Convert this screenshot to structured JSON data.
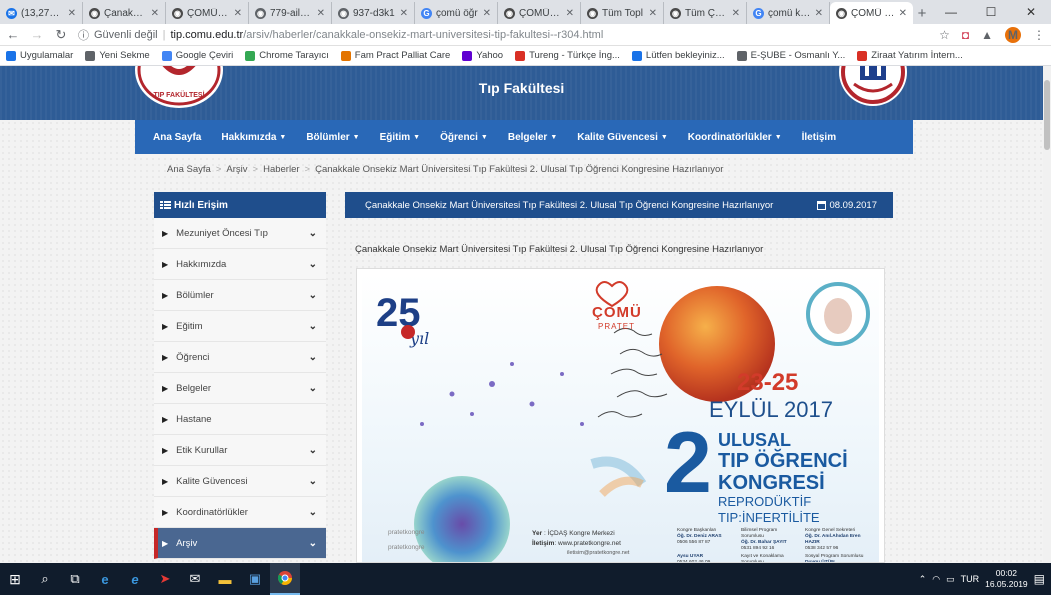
{
  "browser": {
    "tabs": [
      {
        "title": "(13,276 un",
        "color": "#1a73e8",
        "glyph": "✉"
      },
      {
        "title": "Çanakkale",
        "color": "#4a4a4a",
        "glyph": "◉"
      },
      {
        "title": "ÇOMÜ - T",
        "color": "#4a4a4a",
        "glyph": "◉"
      },
      {
        "title": "779-aile-h",
        "color": "#5f6368",
        "glyph": "◉"
      },
      {
        "title": "937-d3k1",
        "color": "#5f6368",
        "glyph": "◉"
      },
      {
        "title": "çomü öğr",
        "color": "#4285f4",
        "glyph": "G"
      },
      {
        "title": "ÇOMÜ - S",
        "color": "#4a4a4a",
        "glyph": "◉"
      },
      {
        "title": "Tüm Topl",
        "color": "#4a4a4a",
        "glyph": "◉"
      },
      {
        "title": "Tüm ÇOM",
        "color": "#4a4a4a",
        "glyph": "◉"
      },
      {
        "title": "çomü kök",
        "color": "#4285f4",
        "glyph": "G"
      },
      {
        "title": "ÇOMÜ - T",
        "color": "#4a4a4a",
        "glyph": "◉",
        "active": true
      }
    ],
    "new_tab": "+",
    "url_security": "Güvenli değil",
    "url_host": "tip.comu.edu.tr",
    "url_path": "/arsiv/haberler/canakkale-onsekiz-mart-universitesi-tip-fakultesi--r304.html",
    "avatar_letter": "M",
    "bookmarks": [
      {
        "label": "Uygulamalar",
        "color": "#1a73e8"
      },
      {
        "label": "Yeni Sekme",
        "color": "#5f6368"
      },
      {
        "label": "Google Çeviri",
        "color": "#4285f4"
      },
      {
        "label": "Chrome Tarayıcı",
        "color": "#34a853"
      },
      {
        "label": "Fam Pract Palliat Care",
        "color": "#e37400"
      },
      {
        "label": "Yahoo",
        "color": "#5f01d1"
      },
      {
        "label": "Tureng - Türkçe İng...",
        "color": "#d93025"
      },
      {
        "label": "Lütfen bekleyiniz...",
        "color": "#1a73e8"
      },
      {
        "label": "E-ŞUBE - Osmanlı Y...",
        "color": "#5f6368"
      },
      {
        "label": "Ziraat Yatırım İntern...",
        "color": "#d93025"
      }
    ]
  },
  "site": {
    "header_title": "Tıp Fakültesi",
    "menu": [
      {
        "label": "Ana Sayfa",
        "caret": false
      },
      {
        "label": "Hakkımızda",
        "caret": true
      },
      {
        "label": "Bölümler",
        "caret": true
      },
      {
        "label": "Eğitim",
        "caret": true
      },
      {
        "label": "Öğrenci",
        "caret": true
      },
      {
        "label": "Belgeler",
        "caret": true
      },
      {
        "label": "Kalite Güvencesi",
        "caret": true
      },
      {
        "label": "Koordinatörlükler",
        "caret": true
      },
      {
        "label": "İletişim",
        "caret": false
      }
    ],
    "breadcrumb": [
      "Ana Sayfa",
      "Arşiv",
      "Haberler",
      "Çanakkale Onsekiz Mart Üniversitesi Tıp Fakültesi 2. Ulusal Tıp Öğrenci Kongresine Hazırlanıyor"
    ],
    "sidebar_title": "Hızlı Erişim",
    "sidebar_items": [
      {
        "label": "Mezuniyet Öncesi Tıp",
        "expandable": true
      },
      {
        "label": "Hakkımızda",
        "expandable": true
      },
      {
        "label": "Bölümler",
        "expandable": true
      },
      {
        "label": "Eğitim",
        "expandable": true
      },
      {
        "label": "Öğrenci",
        "expandable": true
      },
      {
        "label": "Belgeler",
        "expandable": true
      },
      {
        "label": "Hastane",
        "expandable": false
      },
      {
        "label": "Etik Kurullar",
        "expandable": true
      },
      {
        "label": "Kalite Güvencesi",
        "expandable": true
      },
      {
        "label": "Koordinatörlükler",
        "expandable": true
      },
      {
        "label": "Arşiv",
        "expandable": true,
        "active": true
      }
    ],
    "news_header_title": "Çanakkale Onsekiz Mart Üniversitesi Tıp Fakültesi 2. Ulusal Tıp Öğrenci Kongresine Hazırlanıyor",
    "news_date": "08.09.2017",
    "article_title": "Çanakkale Onsekiz Mart Üniversitesi Tıp Fakültesi 2. Ulusal Tıp Öğrenci Kongresine Hazırlanıyor"
  },
  "poster": {
    "comu": "ÇOMÜ",
    "pratet": "PRATET",
    "dates": "23-25",
    "month_year": "EYLÜL 2017",
    "big_number": "2",
    "line1": "ULUSAL",
    "line2": "TIP ÖĞRENCİ",
    "line3": "KONGRESİ",
    "line4": "REPRODÜKTİF",
    "line5": "TIP:İNFERTİLİTE",
    "yer_label": "Yer",
    "yer_value": ": İÇDAŞ Kongre Merkezi",
    "iletisim_label": "İletişim",
    "iletisim_value": ": www.pratetkongre.net",
    "mail": "iletisim@pratetkongre.net",
    "pratet_kongre_1": "pratetkongre",
    "pratet_kongre_2": "pratetkongre",
    "contacts": [
      {
        "role": "Kongre Başkanları",
        "name": "Öğ. Dr. Deniz ARAS",
        "phone": "0506 556 87 87"
      },
      {
        "role": "Bilimsel Program Sorumlusu",
        "name": "Öğ. Dr. Bahar ŞAYIT",
        "phone": "0531 894 92 16"
      },
      {
        "role": "Kongre Genel Sekreteri",
        "name": "Öğ. Dr. Anıl.Ahıdan Eren HAZIR",
        "phone": "0538 342 57 96"
      },
      {
        "role": "",
        "name": "Aysu UYAR",
        "phone": "0534 602 46 09"
      },
      {
        "role": "Kayıt ve Konaklama Sorumlusu",
        "name": "Merve SALIKÇILAR",
        "phone": ""
      },
      {
        "role": "Sosyal Program Sorumlusu",
        "name": "Duygu ÜZÜN",
        "phone": ""
      }
    ]
  },
  "taskbar": {
    "lang": "TUR",
    "time": "00:02",
    "date": "16.05.2019"
  }
}
